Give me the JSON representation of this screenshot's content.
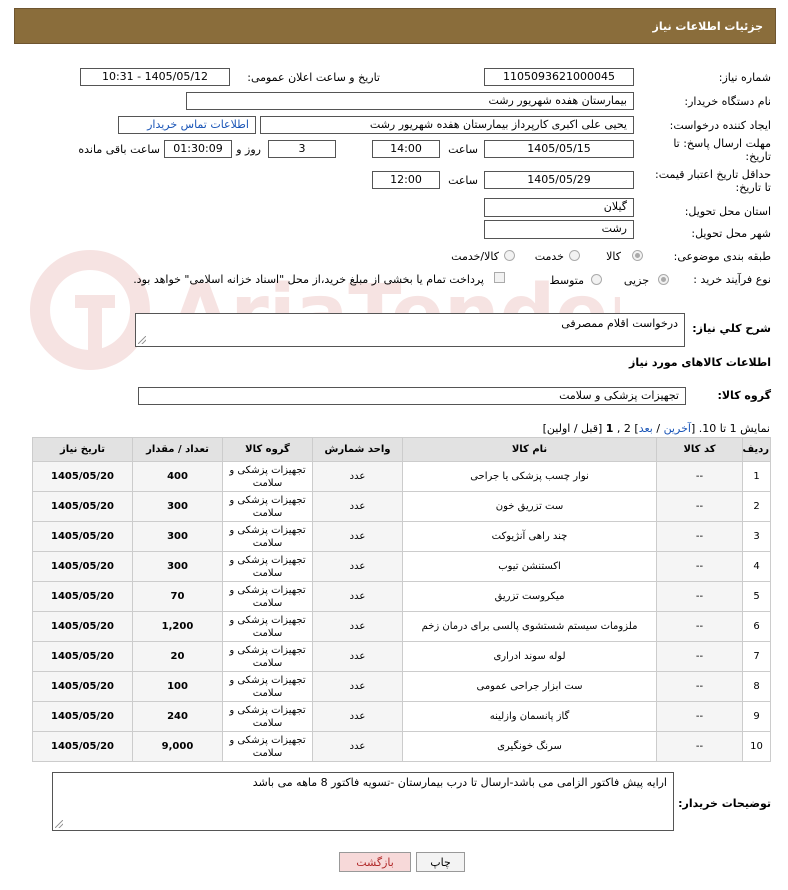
{
  "header": {
    "title": "جزئیات اطلاعات نیاز"
  },
  "form": {
    "need_number": {
      "label": "شماره نیاز:",
      "value": "1105093621000045"
    },
    "announce_dt": {
      "label": "تاریخ و ساعت اعلان عمومی:",
      "value": "1405/05/12 - 10:31"
    },
    "buyer_org": {
      "label": "نام دستگاه خریدار:",
      "value": "بیمارستان هفده شهریور رشت"
    },
    "creator": {
      "label": "ایجاد کننده درخواست:",
      "value": "یحیی علی اکبری کارپرداز بیمارستان هفده شهریور رشت",
      "contact_link": "اطلاعات تماس خریدار"
    },
    "reply_deadline": {
      "label_line1": "مهلت ارسال پاسخ: تا",
      "label_line2": "تاریخ:",
      "date": "1405/05/15",
      "time_label": "ساعت",
      "time": "14:00",
      "days": "3",
      "days_label": "روز و",
      "remaining": "01:30:09",
      "remaining_label": "ساعت باقی مانده"
    },
    "price_validity": {
      "label_line1": "حداقل تاریخ اعتبار قیمت:",
      "label_line2": "تا تاریخ:",
      "date": "1405/05/29",
      "time_label": "ساعت",
      "time": "12:00"
    },
    "province": {
      "label": "استان محل تحویل:",
      "value": "گیلان"
    },
    "city": {
      "label": "شهر محل تحویل:",
      "value": "رشت"
    },
    "category": {
      "label": "طبقه بندی موضوعی:",
      "options": [
        "کالا",
        "خدمت",
        "کالا/خدمت"
      ]
    },
    "process": {
      "label": "نوع فرآیند خرید :",
      "options": [
        "جزیی",
        "متوسط"
      ],
      "payment_note": "پرداخت تمام یا بخشی از مبلغ خرید،از محل \"اسناد خزانه اسلامی\" خواهد بود."
    }
  },
  "description": {
    "label": "شرح كلي نياز:",
    "value": "درخواست اقلام ممصرفی"
  },
  "goods_info": {
    "title": "اطلاعات کالاهای مورد نیاز"
  },
  "goods_group": {
    "label": "گروه کالا:",
    "value": "تجهیزات پزشکی و سلامت"
  },
  "pagination": {
    "prefix": "نمایش 1 تا 10. [",
    "last": "آخرین",
    "sep1": " / ",
    "next": "بعد",
    "suffix_pages": "] 2 ,",
    "current": "1",
    "tail": " [قبل / اولین]"
  },
  "table": {
    "headers": [
      "ردیف",
      "کد کالا",
      "نام کالا",
      "واحد شمارش",
      "گروه کالا",
      "تعداد / مقدار",
      "تاریخ نیاز"
    ],
    "rows": [
      [
        "1",
        "--",
        "نوار چسب پزشکی یا جراحی",
        "عدد",
        "تجهیزات پزشکی و سلامت",
        "400",
        "1405/05/20"
      ],
      [
        "2",
        "--",
        "ست تزریق خون",
        "عدد",
        "تجهیزات پزشکی و سلامت",
        "300",
        "1405/05/20"
      ],
      [
        "3",
        "--",
        "چند راهی آنژیوکت",
        "عدد",
        "تجهیزات پزشکی و سلامت",
        "300",
        "1405/05/20"
      ],
      [
        "4",
        "--",
        "اکستنشن تیوب",
        "عدد",
        "تجهیزات پزشکی و سلامت",
        "300",
        "1405/05/20"
      ],
      [
        "5",
        "--",
        "میکروست تزریق",
        "عدد",
        "تجهیزات پزشکی و سلامت",
        "70",
        "1405/05/20"
      ],
      [
        "6",
        "--",
        "ملزومات سیستم شستشوی پالسی برای درمان زخم",
        "عدد",
        "تجهیزات پزشکی و سلامت",
        "1,200",
        "1405/05/20"
      ],
      [
        "7",
        "--",
        "لوله سوند ادراری",
        "عدد",
        "تجهیزات پزشکی و سلامت",
        "20",
        "1405/05/20"
      ],
      [
        "8",
        "--",
        "ست ابزار جراحی عمومی",
        "عدد",
        "تجهیزات پزشکی و سلامت",
        "100",
        "1405/05/20"
      ],
      [
        "9",
        "--",
        "گاز پانسمان وازلینه",
        "عدد",
        "تجهیزات پزشکی و سلامت",
        "240",
        "1405/05/20"
      ],
      [
        "10",
        "--",
        "سرنگ خونگیری",
        "عدد",
        "تجهیزات پزشکی و سلامت",
        "9,000",
        "1405/05/20"
      ]
    ]
  },
  "buyer_notes": {
    "label": "توضیحات خریدار:",
    "value": "ارایه پیش فاکتور الزامی می باشد-ارسال تا درب بیمارستان -تسویه فاکتور 8 ماهه می باشد"
  },
  "buttons": {
    "print": "چاپ",
    "back": "بازگشت"
  },
  "watermark": "AriaTender.net",
  "colors": {
    "header_bg": "#8a6d3b",
    "link": "#1a55b7",
    "back_btn_bg": "#f7d9d9"
  }
}
